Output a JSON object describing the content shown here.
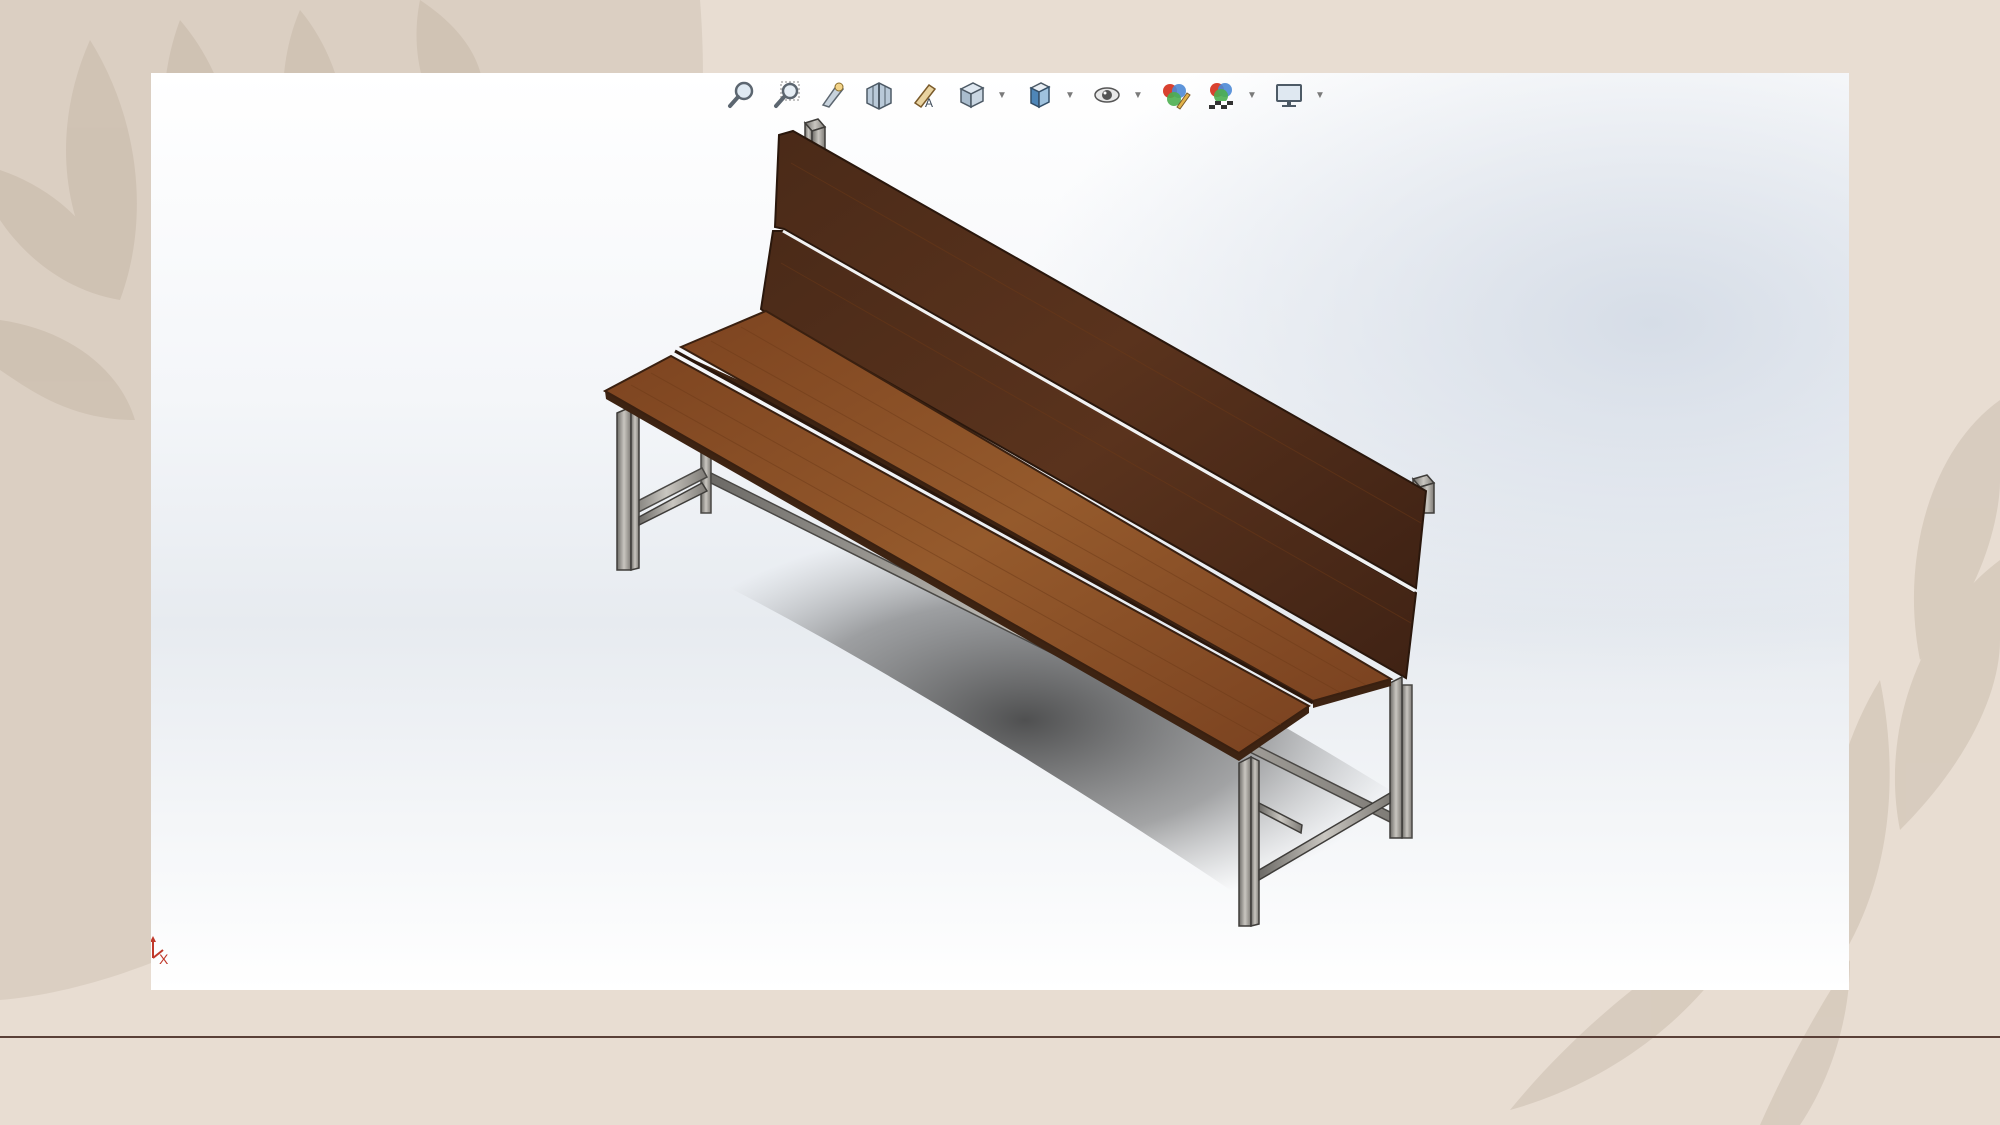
{
  "colors": {
    "slide_background": "#e8ddd2",
    "leaf_pattern": "#d6cbbd",
    "divider": "#5a4038",
    "wood_seat": "#8a4e26",
    "wood_back": "#4e2c1a",
    "steel_frame": "#a9a59f"
  },
  "cad_viewport": {
    "heads_up_toolbar": [
      {
        "icon": "zoom-to-fit-icon"
      },
      {
        "icon": "zoom-to-area-icon"
      },
      {
        "icon": "previous-view-icon"
      },
      {
        "icon": "section-view-icon"
      },
      {
        "icon": "dynamic-annotation-views-icon"
      },
      {
        "icon": "view-orientation-icon",
        "has_dropdown": true
      },
      {
        "icon": "display-style-icon",
        "has_dropdown": true
      },
      {
        "icon": "hide-show-items-icon",
        "has_dropdown": true
      },
      {
        "icon": "edit-appearance-icon"
      },
      {
        "icon": "apply-scene-icon",
        "has_dropdown": true
      },
      {
        "icon": "view-settings-icon",
        "has_dropdown": true
      }
    ],
    "model": {
      "name_icon": "bench-3d-model",
      "seat_planks": 2,
      "backrest_planks": 2
    },
    "triad": {
      "icon": "reference-triad-icon",
      "axis_label": "X"
    }
  }
}
